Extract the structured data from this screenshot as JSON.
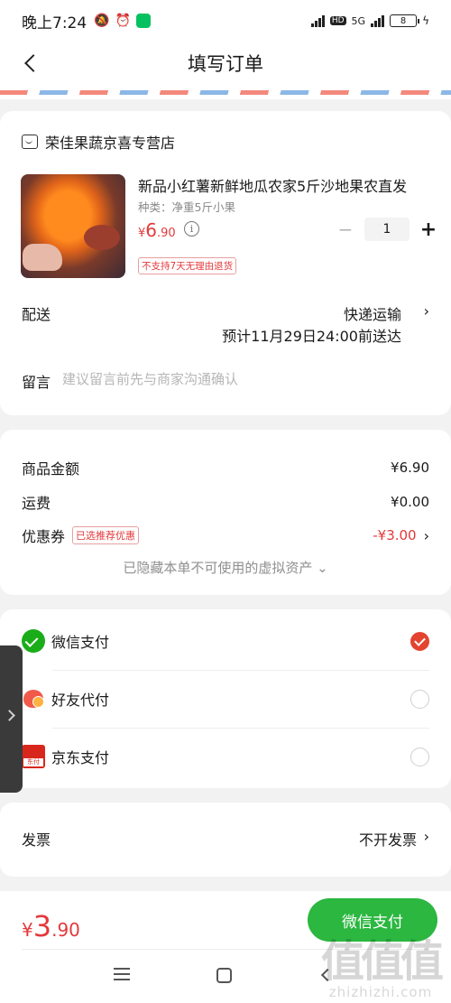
{
  "status_bar": {
    "time": "晚上7:24",
    "hd": "HD",
    "network": "5G",
    "battery": "8"
  },
  "nav": {
    "title": "填写订单"
  },
  "store": {
    "name": "荣佳果蔬京喜专营店",
    "product": {
      "title": "新品小红薯新鲜地瓜农家5斤沙地果农直发",
      "spec": "种类：净重5斤小果",
      "price_symbol": "¥",
      "price_int": "6",
      "price_dec": ".90",
      "quantity": "1",
      "tag": "不支持7天无理由退货"
    },
    "delivery": {
      "label": "配送",
      "method": "快递运输",
      "eta": "预计11月29日24:00前送达"
    },
    "message": {
      "label": "留言",
      "placeholder": "建议留言前先与商家沟通确认"
    }
  },
  "amounts": {
    "goods_label": "商品金额",
    "goods_value": "¥6.90",
    "freight_label": "运费",
    "freight_value": "¥0.00",
    "coupon_label": "优惠券",
    "coupon_tag": "已选推荐优惠",
    "coupon_value": "-¥3.00",
    "hidden_assets": "已隐藏本单不可使用的虚拟资产 ⌄"
  },
  "payment": {
    "options": [
      {
        "label": "微信支付",
        "selected": true
      },
      {
        "label": "好友代付",
        "selected": false
      },
      {
        "label": "京东支付",
        "selected": false
      }
    ],
    "jd_icon_text": "东付"
  },
  "invoice": {
    "label": "发票",
    "value": "不开发票"
  },
  "bottom": {
    "total_symbol": "¥",
    "total_int": "3",
    "total_dec": ".90",
    "pay_button": "微信支付"
  },
  "watermark": {
    "big": "值值值",
    "small": "zhizhizhi.com"
  },
  "icons": {
    "back": "back-arrow-icon",
    "store": "store-icon",
    "info": "info-icon",
    "wechat_pay": "wechat-pay-icon",
    "friend_pay": "friend-pay-icon",
    "jd_pay": "jd-pay-icon"
  },
  "colors": {
    "accent_red": "#e4393c",
    "wechat_green": "#2bb740",
    "check_red": "#e4432f"
  }
}
